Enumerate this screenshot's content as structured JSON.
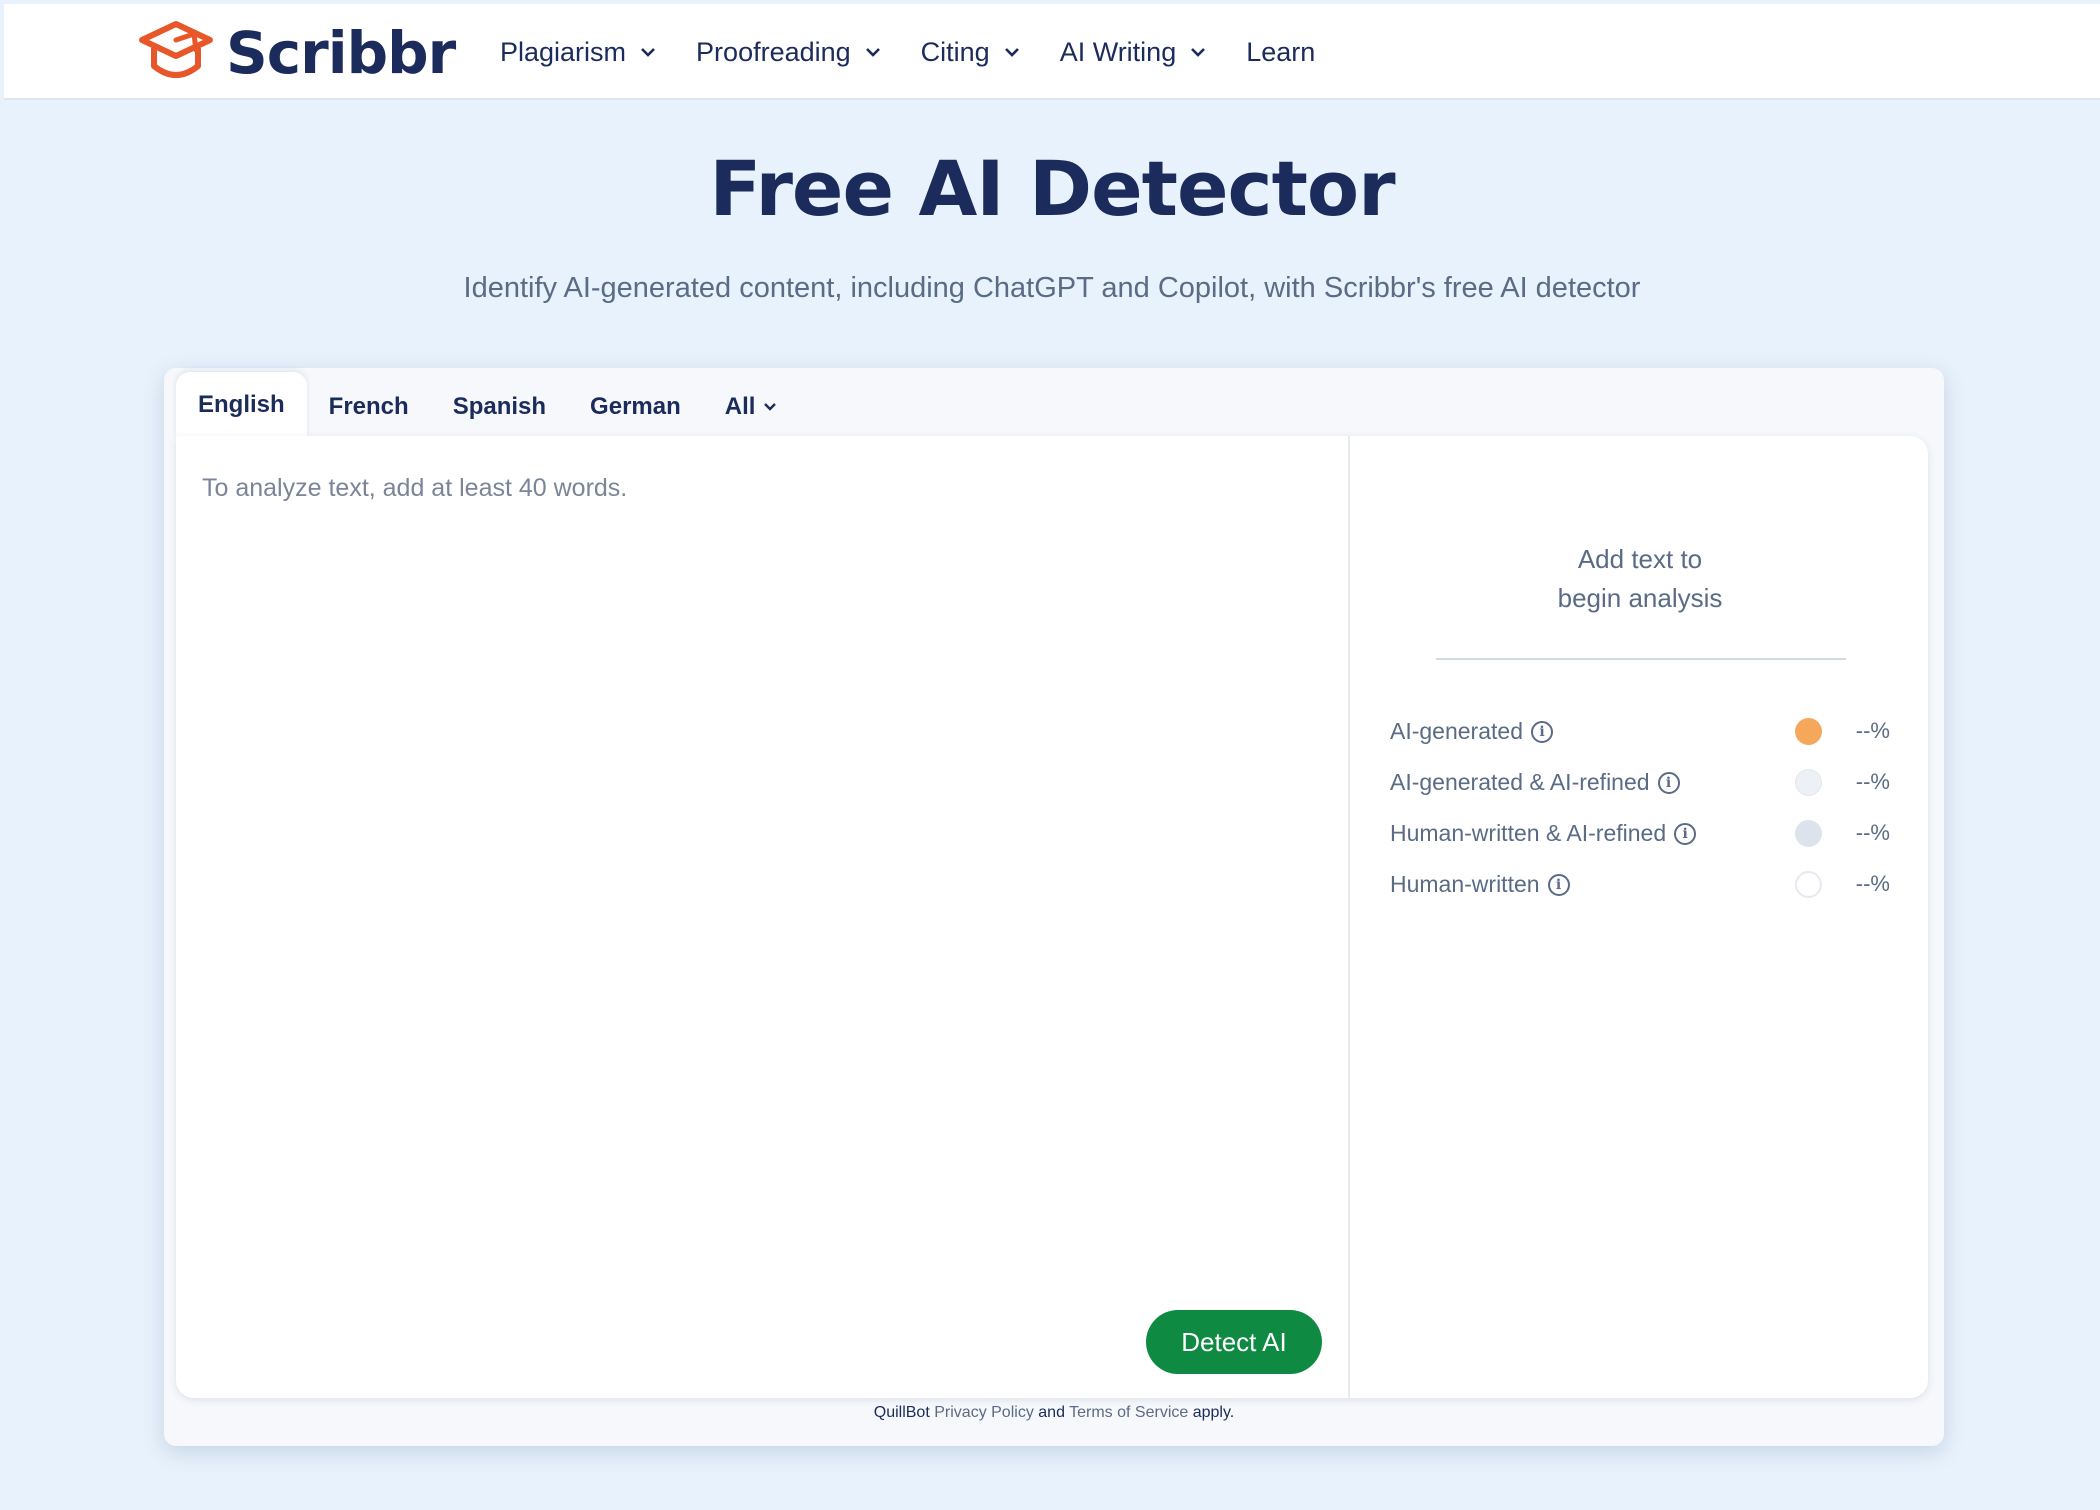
{
  "header": {
    "logo_text": "Scribbr",
    "nav": [
      {
        "label": "Plagiarism",
        "has_dropdown": true
      },
      {
        "label": "Proofreading",
        "has_dropdown": true
      },
      {
        "label": "Citing",
        "has_dropdown": true
      },
      {
        "label": "AI Writing",
        "has_dropdown": true
      },
      {
        "label": "Learn",
        "has_dropdown": false
      }
    ]
  },
  "hero": {
    "title": "Free AI Detector",
    "subtitle": "Identify AI-generated content, including ChatGPT and Copilot, with Scribbr's free AI detector"
  },
  "tabs": [
    {
      "label": "English",
      "active": true
    },
    {
      "label": "French",
      "active": false
    },
    {
      "label": "Spanish",
      "active": false
    },
    {
      "label": "German",
      "active": false
    },
    {
      "label": "All",
      "active": false,
      "has_dropdown": true
    }
  ],
  "editor": {
    "value": "",
    "placeholder": "To analyze text, add at least 40 words.",
    "button_label": "Detect AI"
  },
  "results": {
    "message_line1": "Add text to",
    "message_line2": "begin analysis",
    "legend": [
      {
        "label": "AI-generated",
        "value": "--%",
        "color": "#f5a75c"
      },
      {
        "label": "AI-generated & AI-refined",
        "value": "--%",
        "color": "#edf0f4"
      },
      {
        "label": "Human-written & AI-refined",
        "value": "--%",
        "color": "#dde3ec"
      },
      {
        "label": "Human-written",
        "value": "--%",
        "color": "#ffffff"
      }
    ]
  },
  "footer": {
    "brand": "QuillBot",
    "privacy": "Privacy Policy",
    "and": "and",
    "terms": "Terms of Service",
    "apply": "apply."
  },
  "colors": {
    "brand_orange": "#e8572a",
    "navy": "#1b2b5b",
    "button_green": "#0f8a43",
    "page_bg": "#e8f2fc"
  }
}
